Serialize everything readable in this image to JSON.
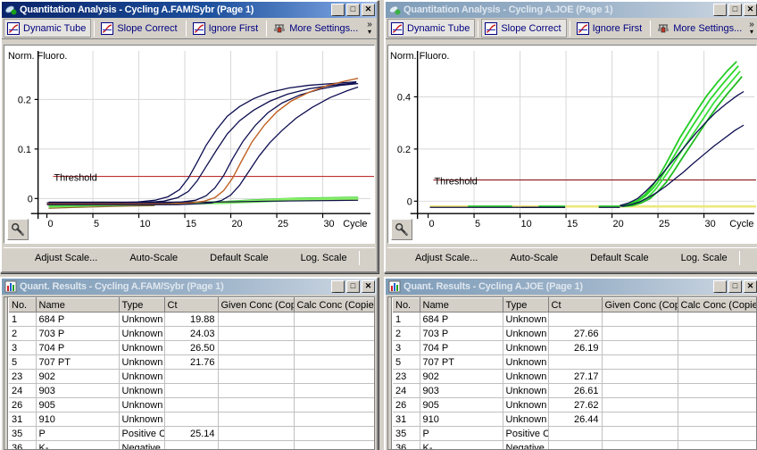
{
  "app": {
    "bg_color": "#d4d0c8",
    "active_title_color": "#0a246a",
    "inactive_title_color": "#7f9db9"
  },
  "windows": {
    "left_chart": {
      "title": "Quantitation Analysis - Cycling A.FAM/Sybr (Page 1)",
      "active": true,
      "icon_name": "quantitation-analysis-icon",
      "sys_buttons": {
        "minimize": "_",
        "maximize": "□",
        "close": "✕"
      },
      "toolbar": {
        "buttons": [
          {
            "label": "Dynamic Tube",
            "icon": "curve-icon",
            "pressed": true
          },
          {
            "label": "Slope Correct",
            "icon": "curve-icon",
            "pressed": false
          },
          {
            "label": "Ignore First",
            "icon": "curve-icon",
            "pressed": false
          },
          {
            "label": "More Settings...",
            "icon": "settings-icon",
            "pressed": false
          }
        ],
        "overflow": "»"
      },
      "scale_buttons": [
        "Adjust Scale...",
        "Auto-Scale",
        "Default Scale",
        "Log. Scale"
      ],
      "zoom_tool_icon": "magnifier-wrench-icon"
    },
    "right_chart": {
      "title": "Quantitation Analysis - Cycling A.JOE (Page 1)",
      "active": false,
      "icon_name": "quantitation-analysis-icon",
      "sys_buttons": {
        "minimize": "_",
        "maximize": "□",
        "close": "✕"
      },
      "toolbar": {
        "buttons": [
          {
            "label": "Dynamic Tube",
            "icon": "curve-icon",
            "pressed": true
          },
          {
            "label": "Slope Correct",
            "icon": "curve-icon",
            "pressed": true
          },
          {
            "label": "Ignore First",
            "icon": "curve-icon",
            "pressed": false
          },
          {
            "label": "More Settings...",
            "icon": "settings-icon",
            "pressed": false
          }
        ],
        "overflow": "»"
      },
      "scale_buttons": [
        "Adjust Scale...",
        "Auto-Scale",
        "Default Scale",
        "Log. Scale"
      ],
      "zoom_tool_icon": "magnifier-wrench-icon"
    },
    "left_results": {
      "title": "Quant. Results - Cycling A.FAM/Sybr (Page 1)",
      "active": false,
      "icon_name": "bar-chart-icon",
      "sys_buttons": {
        "minimize": "_",
        "maximize": "□",
        "close": "✕"
      }
    },
    "right_results": {
      "title": "Quant. Results - Cycling A.JOE (Page 1)",
      "active": false,
      "icon_name": "bar-chart-icon",
      "sys_buttons": {
        "minimize": "_",
        "maximize": "□",
        "close": "✕"
      }
    }
  },
  "results_columns": [
    "No.",
    "Name",
    "Type",
    "Ct",
    "Given Conc (Cop",
    "Calc Conc (Copie"
  ],
  "left_results_rows": [
    {
      "no": "1",
      "name": "684 P",
      "type": "Unknown",
      "ct": "19.88",
      "given": "",
      "calc": ""
    },
    {
      "no": "2",
      "name": "703 P",
      "type": "Unknown",
      "ct": "24.03",
      "given": "",
      "calc": ""
    },
    {
      "no": "3",
      "name": "704 P",
      "type": "Unknown",
      "ct": "26.50",
      "given": "",
      "calc": ""
    },
    {
      "no": "5",
      "name": "707 PT",
      "type": "Unknown",
      "ct": "21.76",
      "given": "",
      "calc": ""
    },
    {
      "no": "23",
      "name": "902",
      "type": "Unknown",
      "ct": "",
      "given": "",
      "calc": ""
    },
    {
      "no": "24",
      "name": "903",
      "type": "Unknown",
      "ct": "",
      "given": "",
      "calc": ""
    },
    {
      "no": "26",
      "name": "905",
      "type": "Unknown",
      "ct": "",
      "given": "",
      "calc": ""
    },
    {
      "no": "31",
      "name": "910",
      "type": "Unknown",
      "ct": "",
      "given": "",
      "calc": ""
    },
    {
      "no": "35",
      "name": "P",
      "type": "Positive C",
      "ct": "25.14",
      "given": "",
      "calc": ""
    },
    {
      "no": "36",
      "name": "K-",
      "type": "Negative",
      "ct": "",
      "given": "",
      "calc": ""
    }
  ],
  "right_results_rows": [
    {
      "no": "1",
      "name": "684 P",
      "type": "Unknown",
      "ct": "",
      "given": "",
      "calc": ""
    },
    {
      "no": "2",
      "name": "703 P",
      "type": "Unknown",
      "ct": "27.66",
      "given": "",
      "calc": ""
    },
    {
      "no": "3",
      "name": "704 P",
      "type": "Unknown",
      "ct": "26.19",
      "given": "",
      "calc": ""
    },
    {
      "no": "5",
      "name": "707 PT",
      "type": "Unknown",
      "ct": "",
      "given": "",
      "calc": ""
    },
    {
      "no": "23",
      "name": "902",
      "type": "Unknown",
      "ct": "27.17",
      "given": "",
      "calc": ""
    },
    {
      "no": "24",
      "name": "903",
      "type": "Unknown",
      "ct": "26.61",
      "given": "",
      "calc": ""
    },
    {
      "no": "26",
      "name": "905",
      "type": "Unknown",
      "ct": "27.62",
      "given": "",
      "calc": ""
    },
    {
      "no": "31",
      "name": "910",
      "type": "Unknown",
      "ct": "26.44",
      "given": "",
      "calc": ""
    },
    {
      "no": "35",
      "name": "P",
      "type": "Positive C",
      "ct": "",
      "given": "",
      "calc": ""
    },
    {
      "no": "36",
      "name": "K-",
      "type": "Negative",
      "ct": "",
      "given": "",
      "calc": ""
    }
  ],
  "chart_data": [
    {
      "id": "fam-sybr-amplification",
      "type": "line",
      "title": "",
      "ylabel": "Norm. Fluoro.",
      "xlabel": "Cycle",
      "xlim": [
        0,
        34
      ],
      "ylim": [
        -0.018,
        0.255
      ],
      "xticks": [
        0,
        5,
        10,
        15,
        20,
        25,
        30
      ],
      "yticks": [
        0,
        0.1,
        0.2
      ],
      "grid": true,
      "threshold": {
        "value": 0.042,
        "label": "Threshold",
        "color": "#c03030"
      },
      "series": [
        {
          "name": "684 P",
          "color": "#0c0c50",
          "ct": 19.88,
          "plateau": 0.225,
          "slope": 0.3,
          "baseline": -0.006
        },
        {
          "name": "707 PT",
          "color": "#0c0c50",
          "ct": 21.76,
          "plateau": 0.228,
          "slope": 0.33,
          "baseline": -0.006
        },
        {
          "name": "703 P",
          "color": "#0c0c50",
          "ct": 24.03,
          "plateau": 0.215,
          "slope": 0.4,
          "baseline": -0.006
        },
        {
          "name": "P",
          "color": "#c06020",
          "ct": 25.14,
          "plateau": 0.245,
          "slope": 0.42,
          "baseline": -0.006
        },
        {
          "name": "704 P",
          "color": "#0c0c50",
          "ct": 26.5,
          "plateau": 0.19,
          "slope": 0.38,
          "baseline": -0.006
        },
        {
          "name": "902",
          "color": "#22cc22",
          "ct": null,
          "plateau": 0.002,
          "slope": 0,
          "baseline": -0.006
        },
        {
          "name": "903",
          "color": "#22cc22",
          "ct": null,
          "plateau": 0.002,
          "slope": 0,
          "baseline": -0.008
        },
        {
          "name": "905",
          "color": "#33dd33",
          "ct": null,
          "plateau": 0.001,
          "slope": 0,
          "baseline": -0.01
        },
        {
          "name": "910",
          "color": "#66ee55",
          "ct": null,
          "plateau": 0.0,
          "slope": 0,
          "baseline": -0.012
        },
        {
          "name": "K-",
          "color": "#cccc33",
          "ct": null,
          "plateau": -0.004,
          "slope": 0,
          "baseline": -0.006
        }
      ]
    },
    {
      "id": "joe-amplification",
      "type": "line",
      "title": "",
      "ylabel": "Norm. Fluoro.",
      "xlabel": "Cycle",
      "xlim": [
        0,
        34
      ],
      "ylim": [
        -0.03,
        0.52
      ],
      "xticks": [
        0,
        5,
        10,
        15,
        20,
        25,
        30
      ],
      "yticks": [
        0,
        0.2,
        0.4
      ],
      "grid": true,
      "threshold": {
        "value": 0.085,
        "label": "Threshold",
        "color": "#8b1a1a"
      },
      "series": [
        {
          "name": "703 P",
          "color": "#22cc22",
          "ct": 27.66,
          "plateau": 0.5,
          "slope": 0.18,
          "baseline": -0.012
        },
        {
          "name": "704 P",
          "color": "#22cc22",
          "ct": 26.19,
          "plateau": 0.48,
          "slope": 0.18,
          "baseline": -0.012
        },
        {
          "name": "902",
          "color": "#33dd33",
          "ct": 27.17,
          "plateau": 0.47,
          "slope": 0.18,
          "baseline": -0.012
        },
        {
          "name": "903",
          "color": "#22cc22",
          "ct": 26.61,
          "plateau": 0.44,
          "slope": 0.17,
          "baseline": -0.012
        },
        {
          "name": "905",
          "color": "#55dd44",
          "ct": 27.62,
          "plateau": 0.43,
          "slope": 0.17,
          "baseline": -0.012
        },
        {
          "name": "910",
          "color": "#0c0c50",
          "ct": 26.44,
          "plateau": 0.34,
          "slope": 0.16,
          "baseline": -0.012
        },
        {
          "name": "684 P",
          "color": "#0c0c50",
          "ct": null,
          "plateau": 0.19,
          "slope": 0.13,
          "baseline": -0.012
        },
        {
          "name": "K-",
          "color": "#e6e63c",
          "ct": null,
          "plateau": -0.016,
          "slope": 0,
          "baseline": -0.016
        }
      ]
    }
  ]
}
